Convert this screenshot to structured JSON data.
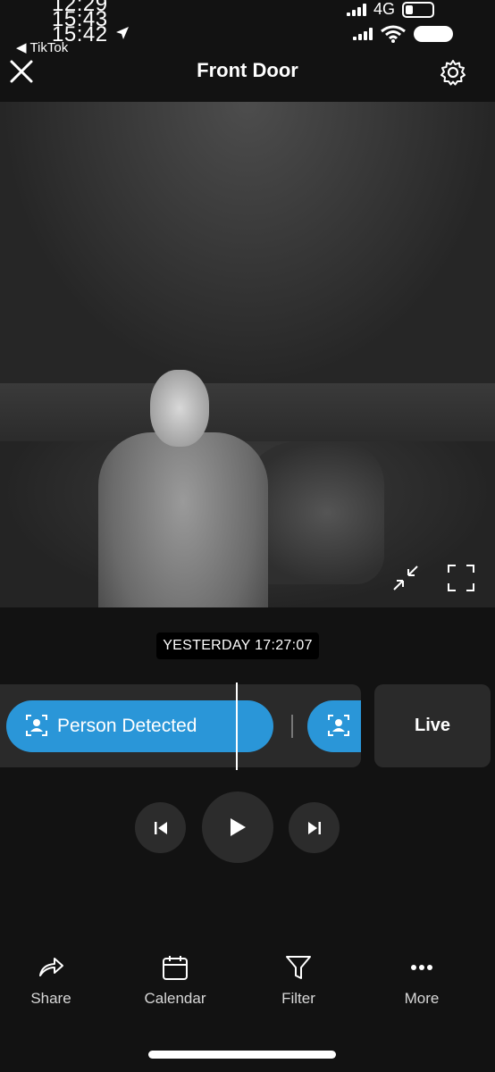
{
  "status_bar": {
    "times": [
      "12:29",
      "15:43",
      "15:42"
    ],
    "back_app": "TikTok",
    "network": "4G"
  },
  "header": {
    "title": "Front Door"
  },
  "video": {
    "timestamp": "YESTERDAY 17:27:07"
  },
  "timeline": {
    "event_label": "Person Detected",
    "live_label": "Live"
  },
  "bottom_nav": {
    "items": [
      {
        "label": "Share",
        "icon": "share-icon"
      },
      {
        "label": "Calendar",
        "icon": "calendar-icon"
      },
      {
        "label": "Filter",
        "icon": "filter-icon"
      },
      {
        "label": "More",
        "icon": "more-icon"
      }
    ]
  },
  "colors": {
    "accent": "#2a96d8",
    "background": "#121212",
    "surface": "#2a2a2a"
  }
}
